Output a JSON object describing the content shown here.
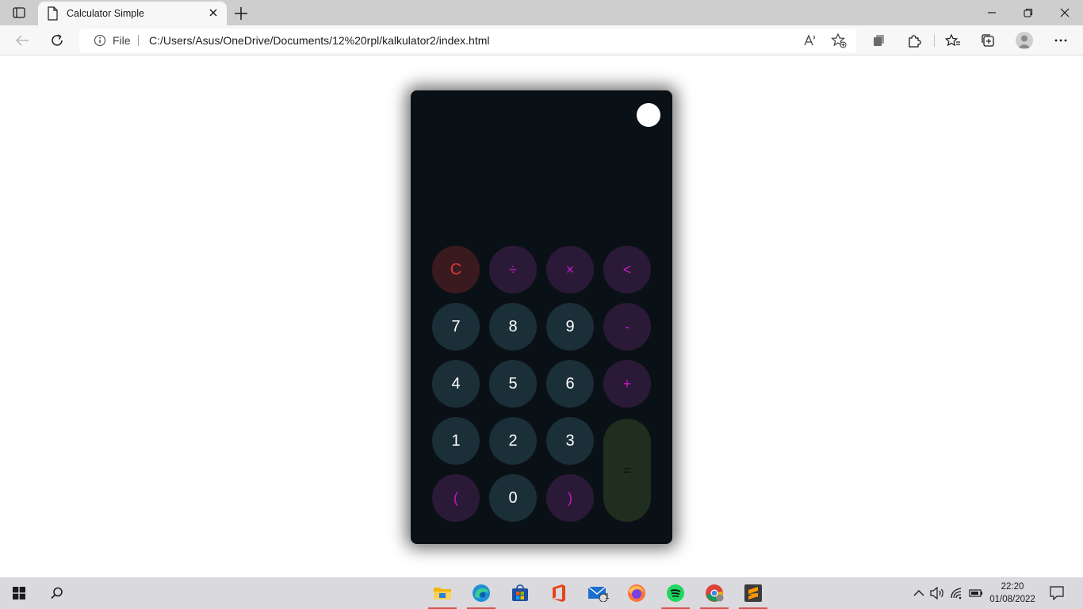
{
  "browser": {
    "tab_title": "Calculator Simple",
    "address_scheme": "File",
    "address_url": "C:/Users/Asus/OneDrive/Documents/12%20rpl/kalkulator2/index.html"
  },
  "calculator": {
    "display": "",
    "keys": {
      "clear": "C",
      "divide": "÷",
      "multiply": "×",
      "backspace": "<",
      "seven": "7",
      "eight": "8",
      "nine": "9",
      "minus": "-",
      "four": "4",
      "five": "5",
      "six": "6",
      "plus": "+",
      "one": "1",
      "two": "2",
      "three": "3",
      "equals": "=",
      "open_paren": "(",
      "zero": "0",
      "close_paren": ")"
    }
  },
  "taskbar": {
    "time": "22:20",
    "date": "01/08/2022",
    "mail_badge": "1"
  },
  "colors": {
    "calculator_bg": "#0a1116",
    "number_key": "#1b2f38",
    "operator_key": "#2b1a37",
    "operator_text": "#c419c0",
    "clear_key": "#3a1a1f",
    "clear_text": "#d53a3a",
    "equals_key": "#1f2e1f"
  }
}
